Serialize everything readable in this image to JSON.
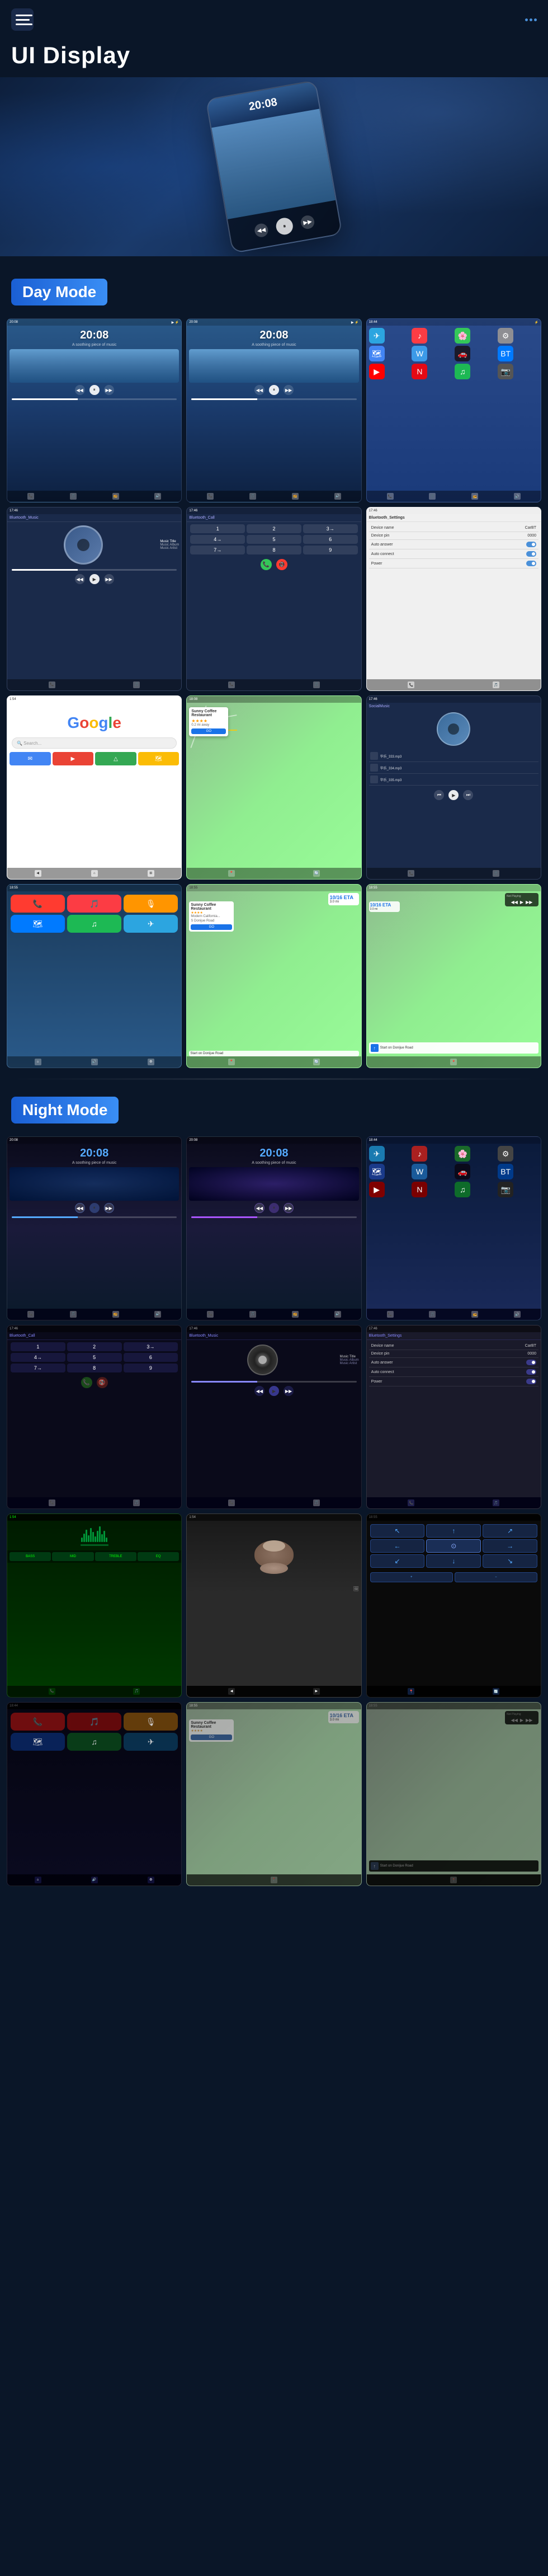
{
  "header": {
    "title": "UI Display",
    "menu_label": "Menu",
    "nav_label": "Navigation"
  },
  "sections": {
    "day_mode": {
      "label": "Day Mode",
      "screens": [
        {
          "id": "day-music-1",
          "type": "music-day",
          "time": "20:08",
          "subtitle": "A soothing piece of music"
        },
        {
          "id": "day-music-2",
          "type": "music-day",
          "time": "20:08",
          "subtitle": "A soothing piece of music"
        },
        {
          "id": "day-apps",
          "type": "apps-day"
        },
        {
          "id": "day-bt-music",
          "type": "bluetooth-music",
          "label": "Bluetooth_Music"
        },
        {
          "id": "day-bt-call",
          "type": "bluetooth-call",
          "label": "Bluetooth_Call"
        },
        {
          "id": "day-bt-settings",
          "type": "bluetooth-settings",
          "label": "Bluetooth_Settings"
        },
        {
          "id": "day-google",
          "type": "google"
        },
        {
          "id": "day-map",
          "type": "map"
        },
        {
          "id": "day-social",
          "type": "social-music",
          "label": "SocialMusic"
        },
        {
          "id": "day-carplay-apps",
          "type": "carplay-apps"
        },
        {
          "id": "day-nav-sunny",
          "type": "nav-sunny"
        },
        {
          "id": "day-nav-notplaying",
          "type": "nav-notplaying"
        }
      ]
    },
    "night_mode": {
      "label": "Night Mode",
      "screens": [
        {
          "id": "night-music-1",
          "type": "music-night",
          "time": "20:08"
        },
        {
          "id": "night-music-2",
          "type": "music-night",
          "time": "20:08"
        },
        {
          "id": "night-apps",
          "type": "apps-night"
        },
        {
          "id": "night-bt-call",
          "type": "bluetooth-call-night",
          "label": "Bluetooth_Call"
        },
        {
          "id": "night-bt-music",
          "type": "bluetooth-music-night",
          "label": "Bluetooth_Music"
        },
        {
          "id": "night-bt-settings",
          "type": "bluetooth-settings-night",
          "label": "Bluetooth_Settings"
        },
        {
          "id": "night-waveform",
          "type": "waveform-night"
        },
        {
          "id": "night-photo",
          "type": "photo-night"
        },
        {
          "id": "night-nav-arrows",
          "type": "nav-arrows-night"
        },
        {
          "id": "night-carplay",
          "type": "carplay-night"
        },
        {
          "id": "night-sunny",
          "type": "nav-sunny-night"
        },
        {
          "id": "night-notplaying",
          "type": "notplaying-night"
        }
      ]
    }
  },
  "bluetooth": {
    "device_name_label": "Device name",
    "device_name_value": "CarBT",
    "device_pin_label": "Device pin",
    "device_pin_value": "0000",
    "auto_answer_label": "Auto answer",
    "auto_connect_label": "Auto connect",
    "power_label": "Power"
  },
  "music": {
    "title": "Music Title",
    "album": "Music Album",
    "artist": "Music Artist"
  },
  "poi": {
    "name": "Sunny Coffee Restaurant",
    "rating": "★★★★",
    "distance": "10/16 ETA",
    "go_label": "GO"
  },
  "navigation": {
    "eta_label": "10/16 ETA",
    "distance": "3.0 mi",
    "turn_label": "Start on Donijue Road"
  },
  "app_colors": {
    "green": "#34c759",
    "red": "#ff3b30",
    "blue": "#007aff",
    "yellow": "#ffcc00",
    "orange": "#ff9500",
    "purple": "#af52de",
    "teal": "#5ac8fa",
    "pink": "#ff2d55"
  }
}
